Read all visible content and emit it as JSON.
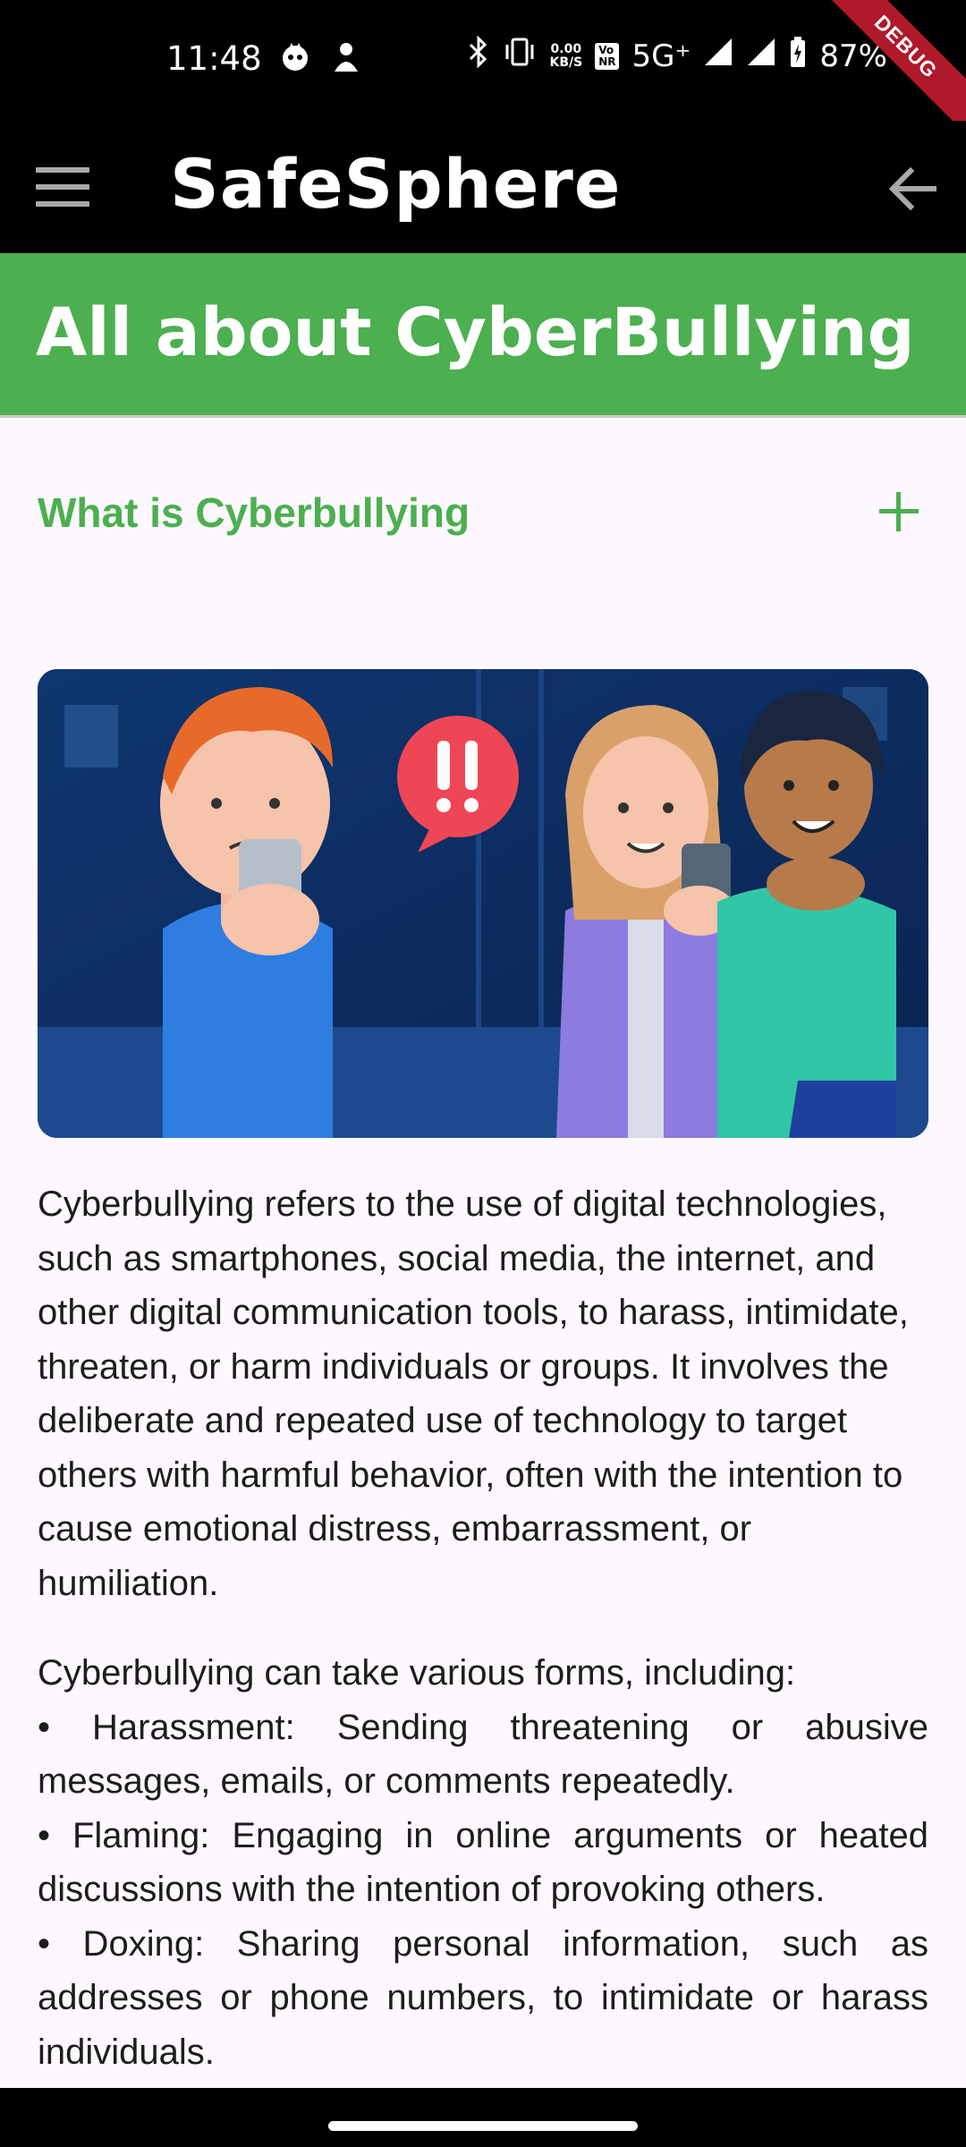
{
  "status_bar": {
    "time": "11:48",
    "net_speed_value": "0.00",
    "net_speed_unit": "KB/S",
    "vo_top": "Vo",
    "vo_bottom": "NR",
    "network": "5G⁺",
    "battery": "87%",
    "debug": "DEBUG"
  },
  "app_bar": {
    "title": "SafeSphere"
  },
  "banner": {
    "title": "All about CyberBullying"
  },
  "accordion": {
    "title": "What is Cyberbullying"
  },
  "article": {
    "intro": "Cyberbullying refers to the use of digital technologies, such as smartphones, social media, the internet, and other digital communication tools, to harass, intimidate, threaten, or harm individuals or groups. It involves the deliberate and repeated use of technology to target others with harmful behavior, often with the intention to cause emotional distress, embarrassment, or humiliation.",
    "forms_heading": "Cyberbullying can take various forms, including:",
    "forms": [
      "• Harassment: Sending threatening or abusive messages, emails, or comments repeatedly.",
      "• Flaming: Engaging in online arguments or heated discussions with the intention of provoking others.",
      "• Doxing: Sharing personal information, such as addresses or phone numbers, to intimidate or harass individuals."
    ]
  },
  "colors": {
    "accent": "#4caf50",
    "app_bar": "#000000",
    "background": "#fdf8fd"
  }
}
